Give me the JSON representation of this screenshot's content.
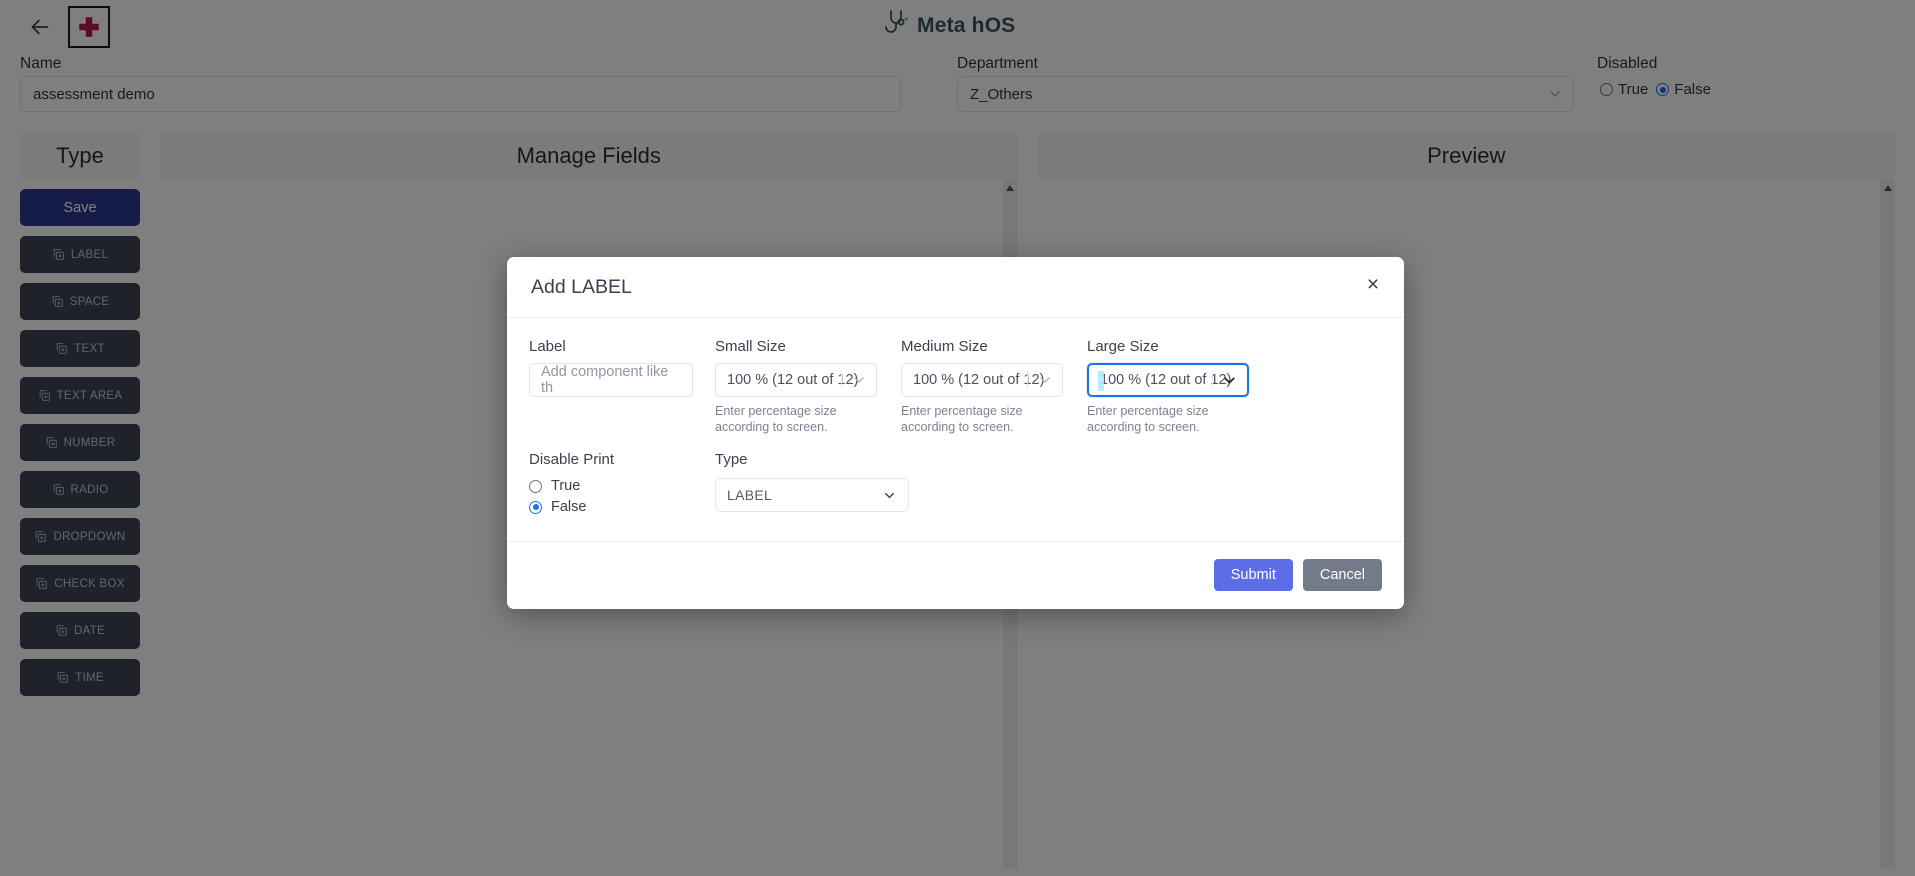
{
  "header": {
    "back_icon": "back-arrow-icon",
    "logo_icon": "red-cross-logo-icon",
    "brand_name": "Meta hOS",
    "brand_icon": "stethoscope-icon"
  },
  "form": {
    "name": {
      "label": "Name",
      "value": "assessment demo"
    },
    "department": {
      "label": "Department",
      "value": "Z_Others",
      "chevron_icon": "chevron-down-icon"
    },
    "disabled": {
      "label": "Disabled",
      "options": [
        "True",
        "False"
      ],
      "selected": "False"
    }
  },
  "panels": {
    "type": {
      "title": "Type",
      "save_label": "Save",
      "items": [
        {
          "label": "LABEL",
          "icon": "add-component-icon"
        },
        {
          "label": "SPACE",
          "icon": "add-component-icon"
        },
        {
          "label": "TEXT",
          "icon": "add-component-icon"
        },
        {
          "label": "TEXT AREA",
          "icon": "add-component-icon"
        },
        {
          "label": "NUMBER",
          "icon": "add-component-icon"
        },
        {
          "label": "RADIO",
          "icon": "add-component-icon"
        },
        {
          "label": "DROPDOWN",
          "icon": "add-component-icon"
        },
        {
          "label": "CHECK BOX",
          "icon": "add-component-icon"
        },
        {
          "label": "DATE",
          "icon": "add-component-icon"
        },
        {
          "label": "TIME",
          "icon": "add-component-icon"
        }
      ]
    },
    "manage_fields": {
      "title": "Manage Fields",
      "scroll_up_icon": "scroll-up-arrow-icon"
    },
    "preview": {
      "title": "Preview",
      "scroll_up_icon": "scroll-up-arrow-icon"
    }
  },
  "modal": {
    "title": "Add LABEL",
    "close_icon": "close-icon",
    "label_field": {
      "label": "Label",
      "value": "",
      "placeholder": "Add component like th"
    },
    "small_size": {
      "label": "Small Size",
      "value": "100 % (12 out of 12)",
      "hint": "Enter percentage size according to screen.",
      "chevron_icon": "chevron-down-icon"
    },
    "medium_size": {
      "label": "Medium Size",
      "value": "100 % (12 out of 12)",
      "hint": "Enter percentage size according to screen.",
      "chevron_icon": "chevron-down-icon"
    },
    "large_size": {
      "label": "Large Size",
      "value": "100 % (12 out of 12)",
      "hint": "Enter percentage size according to screen.",
      "chevron_icon": "chevron-down-icon",
      "focused": true
    },
    "disable_print": {
      "label": "Disable Print",
      "options": [
        "True",
        "False"
      ],
      "selected": "False"
    },
    "type": {
      "label": "Type",
      "value": "LABEL",
      "chevron_icon": "chevron-down-icon"
    },
    "submit_label": "Submit",
    "cancel_label": "Cancel"
  },
  "colors": {
    "save_button": "#2b3990",
    "type_button": "#3e4455",
    "submit_button": "#5b6ee8",
    "cancel_button": "#737a8a",
    "focus_border": "#1a73e8",
    "radio_checked": "#1a73e8",
    "logo_cross": "#b5174b",
    "brand_text": "#3b5162"
  }
}
